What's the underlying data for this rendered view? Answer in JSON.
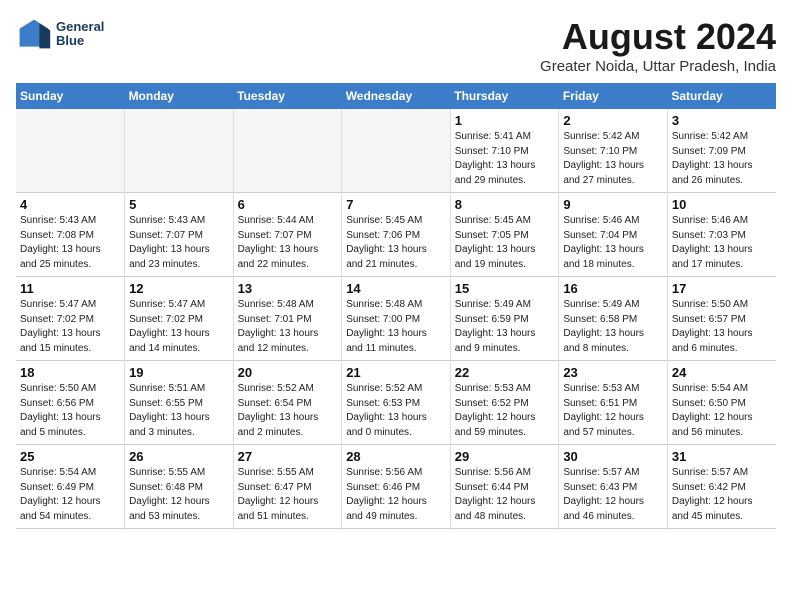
{
  "logo": {
    "line1": "General",
    "line2": "Blue"
  },
  "title": "August 2024",
  "subtitle": "Greater Noida, Uttar Pradesh, India",
  "weekdays": [
    "Sunday",
    "Monday",
    "Tuesday",
    "Wednesday",
    "Thursday",
    "Friday",
    "Saturday"
  ],
  "weeks": [
    [
      {
        "day": "",
        "info": ""
      },
      {
        "day": "",
        "info": ""
      },
      {
        "day": "",
        "info": ""
      },
      {
        "day": "",
        "info": ""
      },
      {
        "day": "1",
        "info": "Sunrise: 5:41 AM\nSunset: 7:10 PM\nDaylight: 13 hours\nand 29 minutes."
      },
      {
        "day": "2",
        "info": "Sunrise: 5:42 AM\nSunset: 7:10 PM\nDaylight: 13 hours\nand 27 minutes."
      },
      {
        "day": "3",
        "info": "Sunrise: 5:42 AM\nSunset: 7:09 PM\nDaylight: 13 hours\nand 26 minutes."
      }
    ],
    [
      {
        "day": "4",
        "info": "Sunrise: 5:43 AM\nSunset: 7:08 PM\nDaylight: 13 hours\nand 25 minutes."
      },
      {
        "day": "5",
        "info": "Sunrise: 5:43 AM\nSunset: 7:07 PM\nDaylight: 13 hours\nand 23 minutes."
      },
      {
        "day": "6",
        "info": "Sunrise: 5:44 AM\nSunset: 7:07 PM\nDaylight: 13 hours\nand 22 minutes."
      },
      {
        "day": "7",
        "info": "Sunrise: 5:45 AM\nSunset: 7:06 PM\nDaylight: 13 hours\nand 21 minutes."
      },
      {
        "day": "8",
        "info": "Sunrise: 5:45 AM\nSunset: 7:05 PM\nDaylight: 13 hours\nand 19 minutes."
      },
      {
        "day": "9",
        "info": "Sunrise: 5:46 AM\nSunset: 7:04 PM\nDaylight: 13 hours\nand 18 minutes."
      },
      {
        "day": "10",
        "info": "Sunrise: 5:46 AM\nSunset: 7:03 PM\nDaylight: 13 hours\nand 17 minutes."
      }
    ],
    [
      {
        "day": "11",
        "info": "Sunrise: 5:47 AM\nSunset: 7:02 PM\nDaylight: 13 hours\nand 15 minutes."
      },
      {
        "day": "12",
        "info": "Sunrise: 5:47 AM\nSunset: 7:02 PM\nDaylight: 13 hours\nand 14 minutes."
      },
      {
        "day": "13",
        "info": "Sunrise: 5:48 AM\nSunset: 7:01 PM\nDaylight: 13 hours\nand 12 minutes."
      },
      {
        "day": "14",
        "info": "Sunrise: 5:48 AM\nSunset: 7:00 PM\nDaylight: 13 hours\nand 11 minutes."
      },
      {
        "day": "15",
        "info": "Sunrise: 5:49 AM\nSunset: 6:59 PM\nDaylight: 13 hours\nand 9 minutes."
      },
      {
        "day": "16",
        "info": "Sunrise: 5:49 AM\nSunset: 6:58 PM\nDaylight: 13 hours\nand 8 minutes."
      },
      {
        "day": "17",
        "info": "Sunrise: 5:50 AM\nSunset: 6:57 PM\nDaylight: 13 hours\nand 6 minutes."
      }
    ],
    [
      {
        "day": "18",
        "info": "Sunrise: 5:50 AM\nSunset: 6:56 PM\nDaylight: 13 hours\nand 5 minutes."
      },
      {
        "day": "19",
        "info": "Sunrise: 5:51 AM\nSunset: 6:55 PM\nDaylight: 13 hours\nand 3 minutes."
      },
      {
        "day": "20",
        "info": "Sunrise: 5:52 AM\nSunset: 6:54 PM\nDaylight: 13 hours\nand 2 minutes."
      },
      {
        "day": "21",
        "info": "Sunrise: 5:52 AM\nSunset: 6:53 PM\nDaylight: 13 hours\nand 0 minutes."
      },
      {
        "day": "22",
        "info": "Sunrise: 5:53 AM\nSunset: 6:52 PM\nDaylight: 12 hours\nand 59 minutes."
      },
      {
        "day": "23",
        "info": "Sunrise: 5:53 AM\nSunset: 6:51 PM\nDaylight: 12 hours\nand 57 minutes."
      },
      {
        "day": "24",
        "info": "Sunrise: 5:54 AM\nSunset: 6:50 PM\nDaylight: 12 hours\nand 56 minutes."
      }
    ],
    [
      {
        "day": "25",
        "info": "Sunrise: 5:54 AM\nSunset: 6:49 PM\nDaylight: 12 hours\nand 54 minutes."
      },
      {
        "day": "26",
        "info": "Sunrise: 5:55 AM\nSunset: 6:48 PM\nDaylight: 12 hours\nand 53 minutes."
      },
      {
        "day": "27",
        "info": "Sunrise: 5:55 AM\nSunset: 6:47 PM\nDaylight: 12 hours\nand 51 minutes."
      },
      {
        "day": "28",
        "info": "Sunrise: 5:56 AM\nSunset: 6:46 PM\nDaylight: 12 hours\nand 49 minutes."
      },
      {
        "day": "29",
        "info": "Sunrise: 5:56 AM\nSunset: 6:44 PM\nDaylight: 12 hours\nand 48 minutes."
      },
      {
        "day": "30",
        "info": "Sunrise: 5:57 AM\nSunset: 6:43 PM\nDaylight: 12 hours\nand 46 minutes."
      },
      {
        "day": "31",
        "info": "Sunrise: 5:57 AM\nSunset: 6:42 PM\nDaylight: 12 hours\nand 45 minutes."
      }
    ]
  ]
}
